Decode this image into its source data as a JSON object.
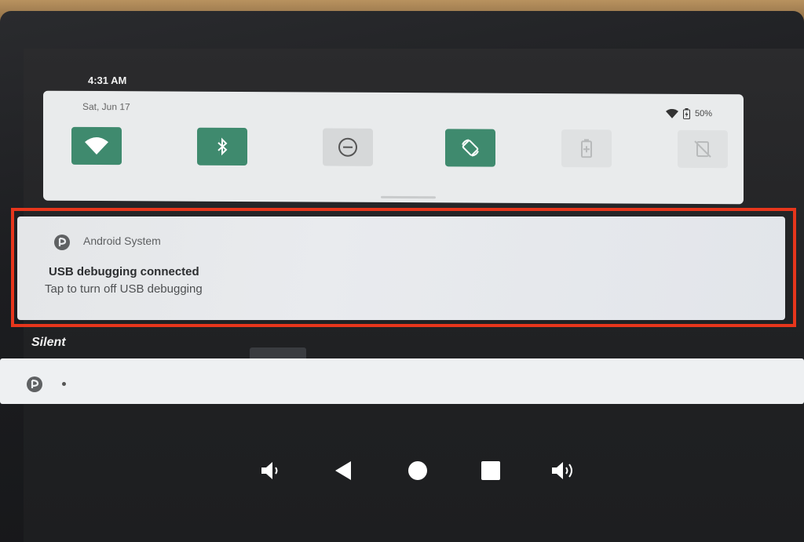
{
  "status_bar": {
    "time": "4:31 AM"
  },
  "quick_settings": {
    "date": "Sat, Jun 17",
    "battery_percent": "50%",
    "tiles": [
      {
        "icon": "wifi-icon",
        "state": "on"
      },
      {
        "icon": "bluetooth-icon",
        "state": "on"
      },
      {
        "icon": "do-not-disturb-icon",
        "state": "off"
      },
      {
        "icon": "auto-rotate-icon",
        "state": "on"
      },
      {
        "icon": "battery-saver-icon",
        "state": "unavailable"
      },
      {
        "icon": "rotation-lock-icon",
        "state": "unavailable"
      }
    ]
  },
  "notification": {
    "app_name": "Android System",
    "title": "USB debugging connected",
    "text": "Tap to turn off USB debugging"
  },
  "silent_section": {
    "header": "Silent"
  },
  "colors": {
    "tile_on": "#3f8a6e",
    "highlight": "#e7361c"
  }
}
